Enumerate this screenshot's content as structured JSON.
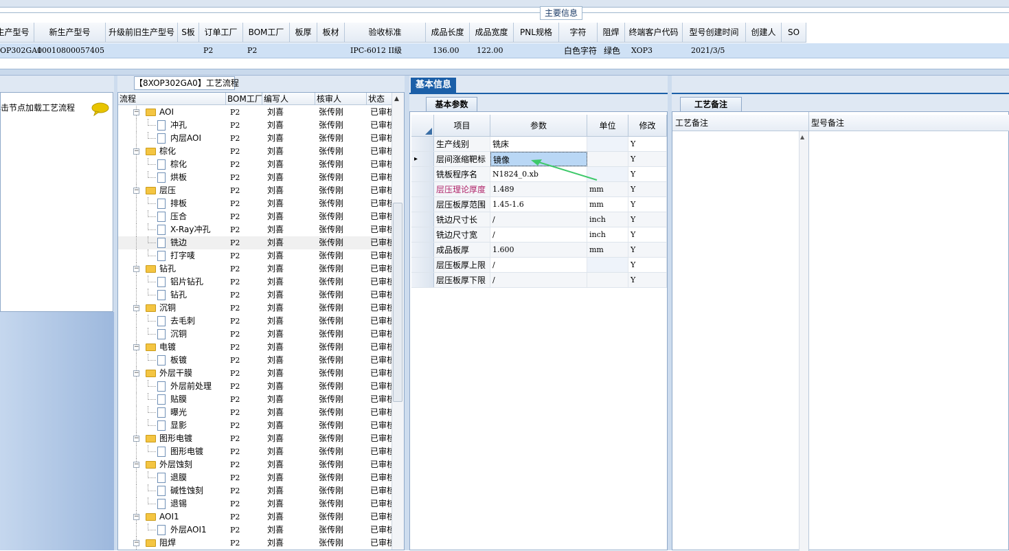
{
  "main_info": {
    "title": "主要信息",
    "columns": [
      "生产型号",
      "新生产型号",
      "升级前旧生产型号",
      "S板",
      "订单工厂",
      "BOM工厂",
      "板厚",
      "板材",
      "验收标准",
      "成品长度",
      "成品宽度",
      "PNL规格",
      "字符",
      "阻焊",
      "终端客户代码",
      "型号创建时间",
      "创建人",
      "SO"
    ],
    "row": {
      "prod_model": "OP302GA0",
      "new_prod_model": "10010800057405",
      "order_factory": "P2",
      "bom_factory": "P2",
      "acceptance": "IPC-6012 II级",
      "length": "136.00",
      "width": "122.00",
      "character": "白色字符",
      "solder_mask": "绿色",
      "customer_code": "XOP3",
      "created_time": "2021/3/5"
    }
  },
  "left_panel": {
    "hint": "单击节点加载工艺流程"
  },
  "process": {
    "title": "【8XOP302GA0】工艺流程",
    "columns": [
      "流程",
      "BOM工厂",
      "编写人",
      "核审人",
      "状态"
    ],
    "rows": [
      {
        "name": "AOI",
        "level": 0,
        "factory": "P2",
        "writer": "刘喜",
        "reviewer": "张传刚",
        "status": "已审核"
      },
      {
        "name": "冲孔",
        "level": 1,
        "factory": "P2",
        "writer": "刘喜",
        "reviewer": "张传刚",
        "status": "已审核"
      },
      {
        "name": "内层AOI",
        "level": 1,
        "factory": "P2",
        "writer": "刘喜",
        "reviewer": "张传刚",
        "status": "已审核"
      },
      {
        "name": "棕化",
        "level": 0,
        "factory": "P2",
        "writer": "刘喜",
        "reviewer": "张传刚",
        "status": "已审核"
      },
      {
        "name": "棕化",
        "level": 1,
        "factory": "P2",
        "writer": "刘喜",
        "reviewer": "张传刚",
        "status": "已审核"
      },
      {
        "name": "烘板",
        "level": 1,
        "factory": "P2",
        "writer": "刘喜",
        "reviewer": "张传刚",
        "status": "已审核"
      },
      {
        "name": "层压",
        "level": 0,
        "factory": "P2",
        "writer": "刘喜",
        "reviewer": "张传刚",
        "status": "已审核"
      },
      {
        "name": "排板",
        "level": 1,
        "factory": "P2",
        "writer": "刘喜",
        "reviewer": "张传刚",
        "status": "已审核"
      },
      {
        "name": "压合",
        "level": 1,
        "factory": "P2",
        "writer": "刘喜",
        "reviewer": "张传刚",
        "status": "已审核"
      },
      {
        "name": "X-Ray冲孔",
        "level": 1,
        "factory": "P2",
        "writer": "刘喜",
        "reviewer": "张传刚",
        "status": "已审核"
      },
      {
        "name": "铣边",
        "level": 1,
        "factory": "P2",
        "writer": "刘喜",
        "reviewer": "张传刚",
        "status": "已审核",
        "selected": true
      },
      {
        "name": "打字唛",
        "level": 1,
        "factory": "P2",
        "writer": "刘喜",
        "reviewer": "张传刚",
        "status": "已审核"
      },
      {
        "name": "钻孔",
        "level": 0,
        "factory": "P2",
        "writer": "刘喜",
        "reviewer": "张传刚",
        "status": "已审核"
      },
      {
        "name": "铝片钻孔",
        "level": 1,
        "factory": "P2",
        "writer": "刘喜",
        "reviewer": "张传刚",
        "status": "已审核"
      },
      {
        "name": "钻孔",
        "level": 1,
        "factory": "P2",
        "writer": "刘喜",
        "reviewer": "张传刚",
        "status": "已审核"
      },
      {
        "name": "沉铜",
        "level": 0,
        "factory": "P2",
        "writer": "刘喜",
        "reviewer": "张传刚",
        "status": "已审核"
      },
      {
        "name": "去毛刺",
        "level": 1,
        "factory": "P2",
        "writer": "刘喜",
        "reviewer": "张传刚",
        "status": "已审核"
      },
      {
        "name": "沉铜",
        "level": 1,
        "factory": "P2",
        "writer": "刘喜",
        "reviewer": "张传刚",
        "status": "已审核"
      },
      {
        "name": "电镀",
        "level": 0,
        "factory": "P2",
        "writer": "刘喜",
        "reviewer": "张传刚",
        "status": "已审核"
      },
      {
        "name": "板镀",
        "level": 1,
        "factory": "P2",
        "writer": "刘喜",
        "reviewer": "张传刚",
        "status": "已审核"
      },
      {
        "name": "外层干膜",
        "level": 0,
        "factory": "P2",
        "writer": "刘喜",
        "reviewer": "张传刚",
        "status": "已审核"
      },
      {
        "name": "外层前处理",
        "level": 1,
        "factory": "P2",
        "writer": "刘喜",
        "reviewer": "张传刚",
        "status": "已审核"
      },
      {
        "name": "贴膜",
        "level": 1,
        "factory": "P2",
        "writer": "刘喜",
        "reviewer": "张传刚",
        "status": "已审核"
      },
      {
        "name": "曝光",
        "level": 1,
        "factory": "P2",
        "writer": "刘喜",
        "reviewer": "张传刚",
        "status": "已审核"
      },
      {
        "name": "显影",
        "level": 1,
        "factory": "P2",
        "writer": "刘喜",
        "reviewer": "张传刚",
        "status": "已审核"
      },
      {
        "name": "图形电镀",
        "level": 0,
        "factory": "P2",
        "writer": "刘喜",
        "reviewer": "张传刚",
        "status": "已审核"
      },
      {
        "name": "图形电镀",
        "level": 1,
        "factory": "P2",
        "writer": "刘喜",
        "reviewer": "张传刚",
        "status": "已审核"
      },
      {
        "name": "外层蚀刻",
        "level": 0,
        "factory": "P2",
        "writer": "刘喜",
        "reviewer": "张传刚",
        "status": "已审核"
      },
      {
        "name": "退膜",
        "level": 1,
        "factory": "P2",
        "writer": "刘喜",
        "reviewer": "张传刚",
        "status": "已审核"
      },
      {
        "name": "碱性蚀刻",
        "level": 1,
        "factory": "P2",
        "writer": "刘喜",
        "reviewer": "张传刚",
        "status": "已审核"
      },
      {
        "name": "退锡",
        "level": 1,
        "factory": "P2",
        "writer": "刘喜",
        "reviewer": "张传刚",
        "status": "已审核"
      },
      {
        "name": "AOI1",
        "level": 0,
        "factory": "P2",
        "writer": "刘喜",
        "reviewer": "张传刚",
        "status": "已审核"
      },
      {
        "name": "外层AOI1",
        "level": 1,
        "factory": "P2",
        "writer": "刘喜",
        "reviewer": "张传刚",
        "status": "已审核"
      },
      {
        "name": "阻焊",
        "level": 0,
        "factory": "P2",
        "writer": "刘喜",
        "reviewer": "张传刚",
        "status": "已审核"
      }
    ]
  },
  "basic_info": {
    "tab": "基本信息",
    "sub_tab": "基本参数",
    "columns": [
      "项目",
      "参数",
      "单位",
      "修改"
    ],
    "rows": [
      {
        "item": "生产线别",
        "value": "铣床",
        "unit": "",
        "modify": "Y"
      },
      {
        "item": "层间涨缩靶标",
        "value": "镜像",
        "unit": "",
        "modify": "Y",
        "current": true
      },
      {
        "item": "铣板程序名",
        "value": "N1824_0.xb",
        "unit": "",
        "modify": "Y"
      },
      {
        "item": "层压理论厚度",
        "value": "1.489",
        "unit": "mm",
        "modify": "Y",
        "highlight": true
      },
      {
        "item": "层压板厚范围",
        "value": "1.45-1.6",
        "unit": "mm",
        "modify": "Y"
      },
      {
        "item": "铣边尺寸长",
        "value": "/",
        "unit": "inch",
        "modify": "Y"
      },
      {
        "item": "铣边尺寸宽",
        "value": "/",
        "unit": "inch",
        "modify": "Y"
      },
      {
        "item": "成品板厚",
        "value": "1.600",
        "unit": "mm",
        "modify": "Y"
      },
      {
        "item": "层压板厚上限",
        "value": "/",
        "unit": "",
        "modify": "Y"
      },
      {
        "item": "层压板厚下限",
        "value": "/",
        "unit": "",
        "modify": "Y"
      }
    ],
    "highlight_color": "#b0246a",
    "arrow_color": "#3ec96a"
  },
  "notes": {
    "tab": "工艺备注",
    "col1": "工艺备注",
    "col2": "型号备注"
  }
}
